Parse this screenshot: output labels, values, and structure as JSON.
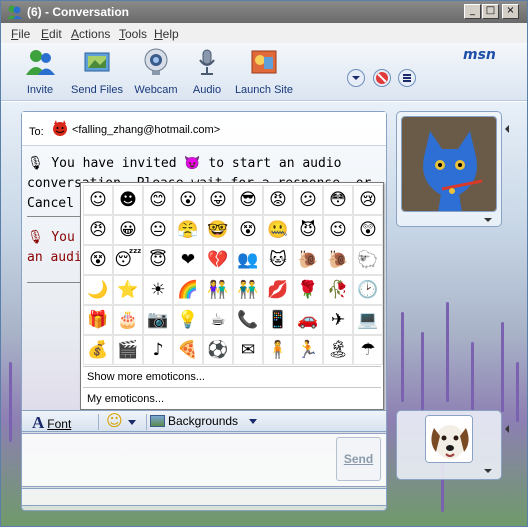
{
  "window": {
    "title": "(6) - Conversation",
    "controls": {
      "minimize": "_",
      "maximize": "□",
      "close": "×"
    }
  },
  "menu": {
    "items": [
      {
        "label": "File",
        "accel": "F",
        "rest": "ile"
      },
      {
        "label": "Edit",
        "accel": "E",
        "rest": "dit"
      },
      {
        "label": "Actions",
        "accel": "A",
        "rest": "ctions"
      },
      {
        "label": "Tools",
        "accel": "T",
        "rest": "ools"
      },
      {
        "label": "Help",
        "accel": "H",
        "rest": "elp"
      }
    ]
  },
  "toolbar": {
    "items": [
      {
        "label": "Invite",
        "icon": "invite-icon"
      },
      {
        "label": "Send Files",
        "icon": "send-files-icon"
      },
      {
        "label": "Webcam",
        "icon": "webcam-icon"
      },
      {
        "label": "Audio",
        "icon": "audio-icon"
      },
      {
        "label": "Launch Site",
        "icon": "launch-site-icon"
      }
    ],
    "logo": "msn"
  },
  "conversation": {
    "to_label": "To:",
    "recipient": "<falling_zhang@hotmail.com>",
    "line1a": "You have invited",
    "line1b": "to start an audio",
    "line2": "conversation. Please wait for a response, or",
    "line3": "Cancel",
    "line4": "You h",
    "line5": "an audi"
  },
  "emoticons": {
    "grid": [
      "☺",
      "☻",
      "😊",
      "😮",
      "😛",
      "😎",
      "😡",
      "😕",
      "😳",
      "😢",
      "😠",
      "😀",
      "😐",
      "😤",
      "🤓",
      "😵",
      "🤐",
      "😈",
      "😉",
      "😲",
      "😵",
      "😴",
      "😇",
      "❤",
      "💔",
      "👥",
      "🐱",
      "🐌",
      "🐌",
      "🐑",
      "🌙",
      "⭐",
      "☀",
      "🌈",
      "👫",
      "👬",
      "💋",
      "🌹",
      "🥀",
      "🕑",
      "🎁",
      "🎂",
      "📷",
      "💡",
      "☕",
      "📞",
      "📱",
      "🚗",
      "✈",
      "💻",
      "💰",
      "🎬",
      "♪",
      "🍕",
      "⚽",
      "✉",
      "🧍",
      "🏃",
      "🏝",
      "☂"
    ],
    "show_more": "Show more emoticons...",
    "my_emoticons": "My emoticons..."
  },
  "format_bar": {
    "font_letter": "A",
    "font_label": "Font",
    "emoticon_face": "☺",
    "backgrounds_label": "Backgrounds"
  },
  "send": {
    "label": "Send"
  },
  "colors": {
    "accent": "#1f4fa8",
    "title_bar": "#7a7a7a"
  }
}
